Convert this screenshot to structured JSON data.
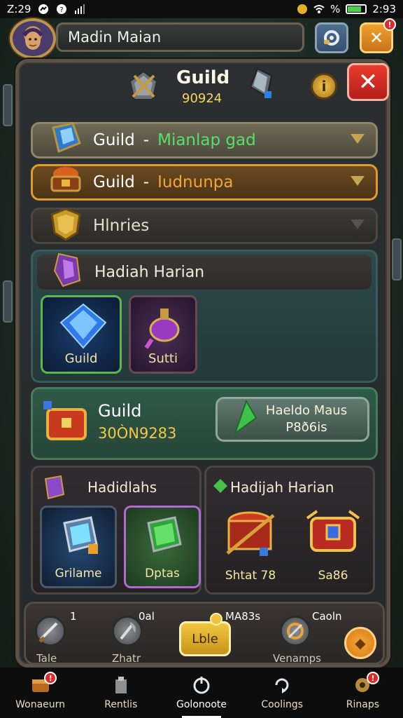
{
  "status_bar": {
    "time_left": "Z:29",
    "battery_percent": "%",
    "time_right": "2:93"
  },
  "header": {
    "player_name": "Madin Maian",
    "close_badge": "!"
  },
  "panel": {
    "title": "Guild",
    "subtitle": "90924",
    "info_label": "i",
    "close_label": "✕"
  },
  "rows": [
    {
      "label": "Guild",
      "dash": "-",
      "value": "Mianlap gad",
      "value_color": "#56e06a"
    },
    {
      "label": "Guild",
      "dash": "-",
      "value": "Iudnunpa",
      "value_color": "#f2a43c"
    },
    {
      "label": "Hlnries",
      "dash": "",
      "value": "",
      "value_color": "#e6ddc8"
    }
  ],
  "section_a": {
    "title": "Hadiah Harian",
    "items": [
      {
        "label": "Guild"
      },
      {
        "label": "Sutti"
      }
    ]
  },
  "guild_box": {
    "title": "Guild",
    "value": "30ÒN9283",
    "button_line1": "Haeldo Maus",
    "button_line2": "P8ð6is"
  },
  "section_left": {
    "title": "Hadidlahs",
    "items": [
      {
        "label": "Grilame"
      },
      {
        "label": "Dptas"
      }
    ]
  },
  "section_right": {
    "title": "Hadijah Harian",
    "items": [
      {
        "label": "Shtat 78"
      },
      {
        "label": "Sa86"
      }
    ]
  },
  "strip": {
    "count1": "1",
    "count2": "0al",
    "count3": "MA83s",
    "count4": "Caoln",
    "label1": "Tale",
    "label2": "Zhatr",
    "label3": "Venamps",
    "center_button": "Lble"
  },
  "bottom_nav": [
    {
      "label": "Wonaeurn",
      "badge": "!"
    },
    {
      "label": "Rentlis",
      "badge": ""
    },
    {
      "label": "Golonoote",
      "badge": ""
    },
    {
      "label": "Coolings",
      "badge": ""
    },
    {
      "label": "Rinaps",
      "badge": "!"
    }
  ],
  "colors": {
    "accent_gold": "#f5d560",
    "close_red": "#d42a22",
    "green_border": "#5bb84e",
    "panel_bg": "#2b2f31"
  }
}
